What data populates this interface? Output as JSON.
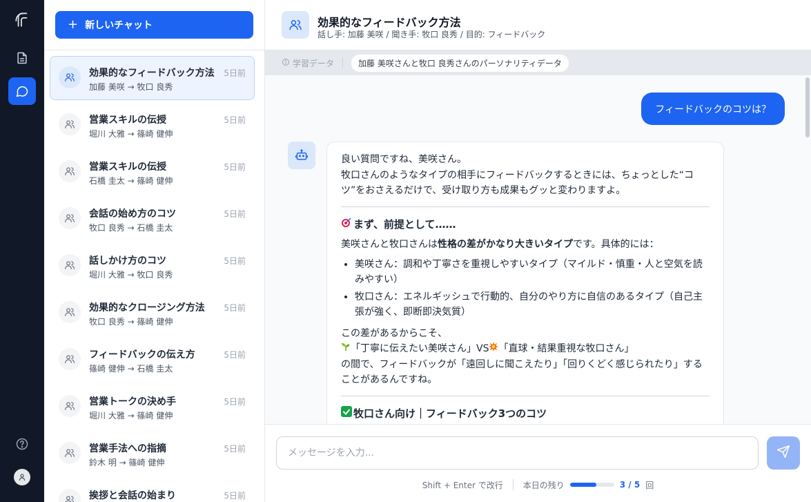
{
  "sidebar": {
    "new_chat_label": "新しいチャット",
    "conversations": [
      {
        "title": "効果的なフィードバック方法",
        "sub": "加藤 美咲 → 牧口 良秀",
        "time": "5日前"
      },
      {
        "title": "営業スキルの伝授",
        "sub": "堀川 大雅 → 篠崎 健伸",
        "time": "5日前"
      },
      {
        "title": "営業スキルの伝授",
        "sub": "石橋 圭太 → 篠崎 健伸",
        "time": "5日前"
      },
      {
        "title": "会話の始め方のコツ",
        "sub": "牧口 良秀 → 石橋 圭太",
        "time": "5日前"
      },
      {
        "title": "話しかけ方のコツ",
        "sub": "堀川 大雅 → 牧口 良秀",
        "time": "5日前"
      },
      {
        "title": "効果的なクロージング方法",
        "sub": "牧口 良秀 → 篠崎 健伸",
        "time": "5日前"
      },
      {
        "title": "フィードバックの伝え方",
        "sub": "篠崎 健伸 → 石橋 圭太",
        "time": "5日前"
      },
      {
        "title": "営業トークの決め手",
        "sub": "堀川 大雅 → 篠崎 健伸",
        "time": "5日前"
      },
      {
        "title": "営業手法への指摘",
        "sub": "鈴木 明 → 篠崎 健伸",
        "time": "5日前"
      },
      {
        "title": "挨拶と会話の始まり",
        "sub": "",
        "time": "5日前"
      }
    ]
  },
  "header": {
    "title": "効果的なフィードバック方法",
    "subtitle": "話し手: 加藤 美咲 / 聞き手: 牧口 良秀 / 目的: フィードバック"
  },
  "infobar": {
    "label": "学習データ",
    "chip": "加藤 美咲さんと牧口 良秀さんのパーソナリティデータ"
  },
  "chat": {
    "user_message": "フィードバックのコツは？",
    "bot": {
      "p1": "良い質問ですね、美咲さん。",
      "p2": "牧口さんのようなタイプの相手にフィードバックするときには、ちょっとした“コツ”をおさえるだけで、受け取り方も成果もグッと変わりますよ。",
      "h1": "まず、前提として……",
      "intro_a": "美咲さんと牧口さんは",
      "intro_b": "性格の差がかなり大きいタイプ",
      "intro_c": "です。具体的には：",
      "li1": "美咲さん：調和や丁寧さを重視しやすいタイプ（マイルド・慎重・人と空気を読みやすい）",
      "li2": "牧口さん：エネルギッシュで行動的、自分のやり方に自信のあるタイプ（自己主張が強く、即断即決気質）",
      "p3": "この差があるからこそ、",
      "p4a": "「丁寧に伝えたい美咲さん」VS",
      "p4b": "「直球・結果重視な牧口さん」",
      "p5": "の間で、フィードバックが「遠回しに聞こえたり」「回りくどく感じられたり」することがあるんですね。",
      "h2": "牧口さん向け｜フィードバック3つのコツ"
    }
  },
  "composer": {
    "placeholder": "メッセージを入力...",
    "hint": "Shift + Enter で改行",
    "remaining_label": "本日の残り",
    "remaining_count": "3 / 5",
    "remaining_unit": "回",
    "remaining_fraction": 0.6
  },
  "colors": {
    "accent": "#1d64f2",
    "rail": "#111827"
  }
}
